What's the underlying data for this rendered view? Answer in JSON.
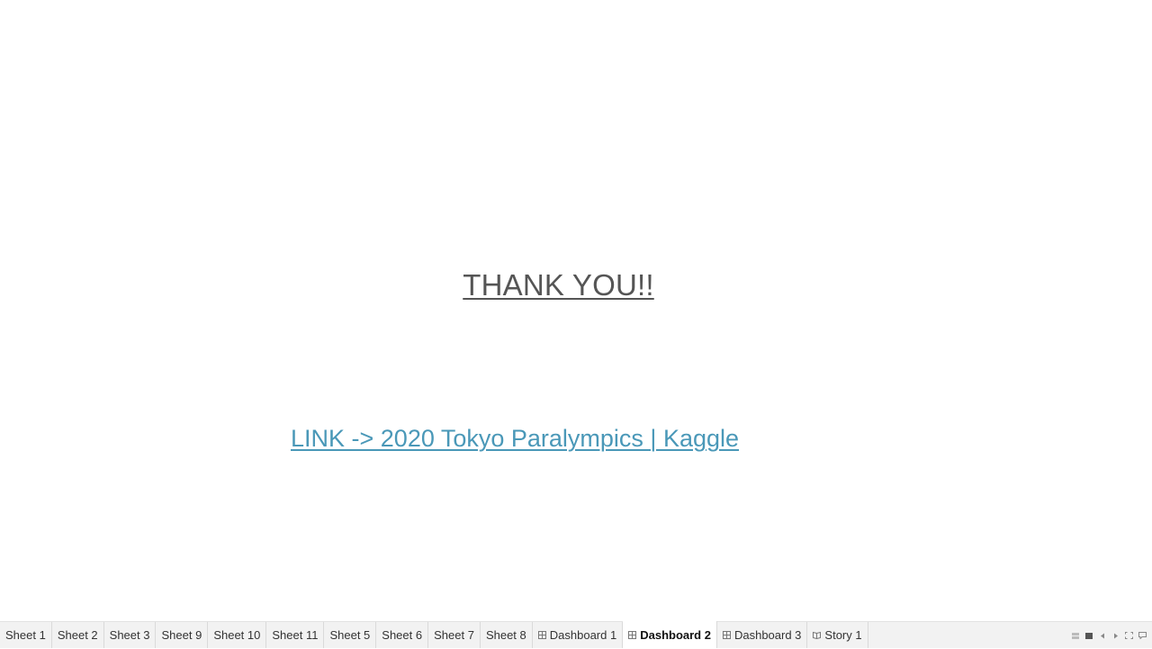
{
  "dashboard": {
    "heading": "THANK YOU!!",
    "link_text": "LINK -> 2020 Tokyo Paralympics | Kaggle"
  },
  "tabs": [
    {
      "label": "Sheet 1",
      "type": "sheet",
      "active": false
    },
    {
      "label": "Sheet 2",
      "type": "sheet",
      "active": false
    },
    {
      "label": "Sheet 3",
      "type": "sheet",
      "active": false
    },
    {
      "label": "Sheet 9",
      "type": "sheet",
      "active": false
    },
    {
      "label": "Sheet 10",
      "type": "sheet",
      "active": false
    },
    {
      "label": "Sheet 11",
      "type": "sheet",
      "active": false
    },
    {
      "label": "Sheet 5",
      "type": "sheet",
      "active": false
    },
    {
      "label": "Sheet 6",
      "type": "sheet",
      "active": false
    },
    {
      "label": "Sheet 7",
      "type": "sheet",
      "active": false
    },
    {
      "label": "Sheet 8",
      "type": "sheet",
      "active": false
    },
    {
      "label": "Dashboard 1",
      "type": "dashboard",
      "active": false
    },
    {
      "label": "Dashboard 2",
      "type": "dashboard",
      "active": true
    },
    {
      "label": "Dashboard 3",
      "type": "dashboard",
      "active": false
    },
    {
      "label": "Story 1",
      "type": "story",
      "active": false
    }
  ],
  "controls": [
    {
      "icon": "show-filmstrip-icon"
    },
    {
      "icon": "show-tabs-icon"
    },
    {
      "icon": "previous-sheet-icon"
    },
    {
      "icon": "next-sheet-icon"
    },
    {
      "icon": "presentation-mode-icon"
    },
    {
      "icon": "comment-icon"
    }
  ],
  "colors": {
    "heading": "#555555",
    "link": "#4a98b8",
    "tabbar_bg": "#f2f2f2"
  }
}
